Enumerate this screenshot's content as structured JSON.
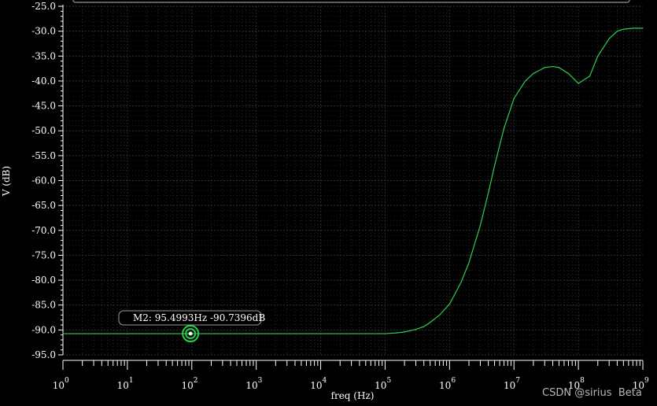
{
  "chart_data": {
    "type": "line",
    "xscale": "log",
    "xlabel": "freq (Hz)",
    "ylabel": "V (dB)",
    "xlim": [
      1,
      1000000000
    ],
    "ylim": [
      -95.0,
      -25.0
    ],
    "grid": true,
    "y_ticks": [
      "-25.0",
      "-30.0",
      "-35.0",
      "-40.0",
      "-45.0",
      "-50.0",
      "-55.0",
      "-60.0",
      "-65.0",
      "-70.0",
      "-75.0",
      "-80.0",
      "-85.0",
      "-90.0",
      "-95.0"
    ],
    "x_ticks": [
      {
        "base": "10",
        "exp": "0"
      },
      {
        "base": "10",
        "exp": "1"
      },
      {
        "base": "10",
        "exp": "2"
      },
      {
        "base": "10",
        "exp": "3"
      },
      {
        "base": "10",
        "exp": "4"
      },
      {
        "base": "10",
        "exp": "5"
      },
      {
        "base": "10",
        "exp": "6"
      },
      {
        "base": "10",
        "exp": "7"
      },
      {
        "base": "10",
        "exp": "8"
      },
      {
        "base": "10",
        "exp": "9"
      }
    ],
    "series": [
      {
        "color": "#2ecc52",
        "x": [
          1,
          10,
          100,
          1000,
          10000,
          100000,
          150000,
          200000,
          300000,
          400000,
          500000,
          700000,
          1000000,
          1500000,
          2000000,
          3000000,
          4000000,
          5000000,
          7000000,
          10000000,
          15000000,
          20000000,
          30000000,
          40000000,
          50000000,
          70000000,
          100000000,
          150000000,
          200000000,
          300000000,
          400000000,
          500000000,
          700000000,
          1000000000
        ],
        "y": [
          -90.74,
          -90.74,
          -90.74,
          -90.74,
          -90.74,
          -90.74,
          -90.6,
          -90.4,
          -89.9,
          -89.3,
          -88.5,
          -87.0,
          -84.8,
          -80.5,
          -76.5,
          -69.0,
          -62.5,
          -57.0,
          -49.5,
          -43.5,
          -40.0,
          -38.5,
          -37.3,
          -37.1,
          -37.3,
          -38.5,
          -40.5,
          -39.0,
          -35.0,
          -31.5,
          -30.0,
          -29.6,
          -29.4,
          -29.4
        ]
      }
    ],
    "markers": [
      {
        "label": "M2: 95.4993Hz -90.7396dB",
        "x": 95.4993,
        "y": -90.7396
      }
    ]
  },
  "watermark": "CSDN @sirius  Beta"
}
